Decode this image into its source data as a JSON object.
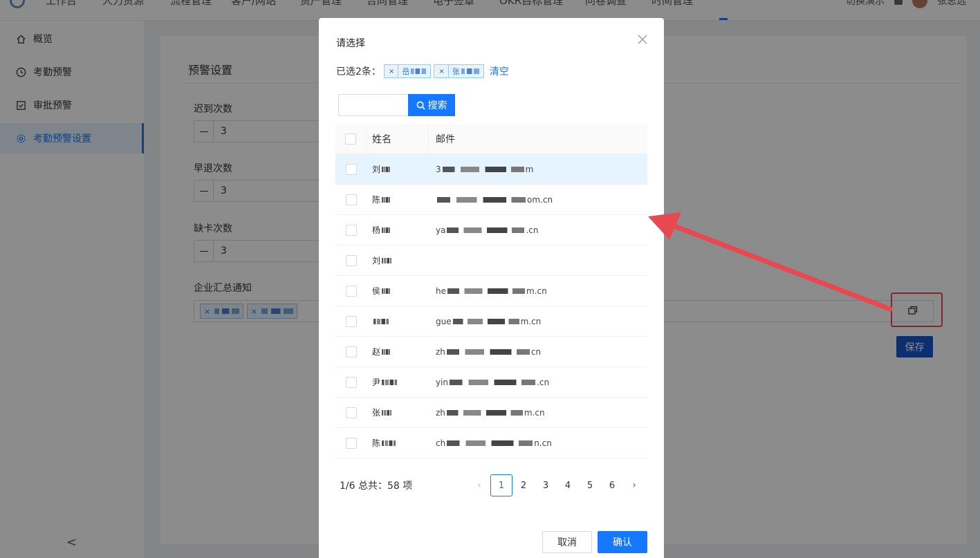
{
  "nav": {
    "items": [
      "工作台",
      "人力资源",
      "流程管理",
      "客户/网站",
      "资产管理",
      "合同管理",
      "电子签章",
      "OKR目标管理",
      "问卷调查",
      "时间管理"
    ],
    "user_label": "切换演示",
    "username": "张思远"
  },
  "sidebar": {
    "items": [
      {
        "label": "概览",
        "icon": "home-icon"
      },
      {
        "label": "考勤预警",
        "icon": "clock-icon"
      },
      {
        "label": "审批预警",
        "icon": "checkbox-icon"
      },
      {
        "label": "考勤预警设置",
        "icon": "gear-icon"
      }
    ],
    "active": "考勤预警设置",
    "collapse_glyph": "<"
  },
  "settings": {
    "title": "预警设置",
    "late_label": "迟到次数",
    "late_value": "3",
    "early_label": "早退次数",
    "early_value": "3",
    "missing_label": "缺卡次数",
    "missing_value": "3",
    "notify_label": "企业汇总通知",
    "save_label": "保存"
  },
  "modal": {
    "title": "请选择",
    "selected_label": "已选2条：",
    "selected_tags": [
      "岳",
      "张"
    ],
    "clear_label": "清空",
    "search_placeholder": "",
    "search_label": "搜索",
    "col_name": "姓名",
    "col_email": "邮件",
    "rows": [
      {
        "name": "刘",
        "email_start": "3",
        "email_end": "m"
      },
      {
        "name": "陈",
        "email_start": "",
        "email_end": "om.cn"
      },
      {
        "name": "杨",
        "email_start": "ya",
        "email_end": ".cn"
      },
      {
        "name": "刘",
        "email_start": "",
        "email_end": ""
      },
      {
        "name": "侯",
        "email_start": "he",
        "email_end": "m.cn"
      },
      {
        "name": "",
        "email_start": "gue",
        "email_end": "m.cn"
      },
      {
        "name": "赵",
        "email_start": "zh",
        "email_end": "cn"
      },
      {
        "name": "尹",
        "email_start": "yin",
        "email_end": ".cn"
      },
      {
        "name": "张",
        "email_start": "zh",
        "email_end": "m.cn"
      },
      {
        "name": "陈",
        "email_start": "ch",
        "email_end": "n.cn"
      }
    ],
    "pager_total": "1/6 总共：58 项",
    "pages": [
      "1",
      "2",
      "3",
      "4",
      "5",
      "6"
    ],
    "current_page": "1",
    "cancel_label": "取消",
    "ok_label": "确认"
  },
  "colors": {
    "primary": "#1677ff",
    "callout": "#e8484f"
  }
}
